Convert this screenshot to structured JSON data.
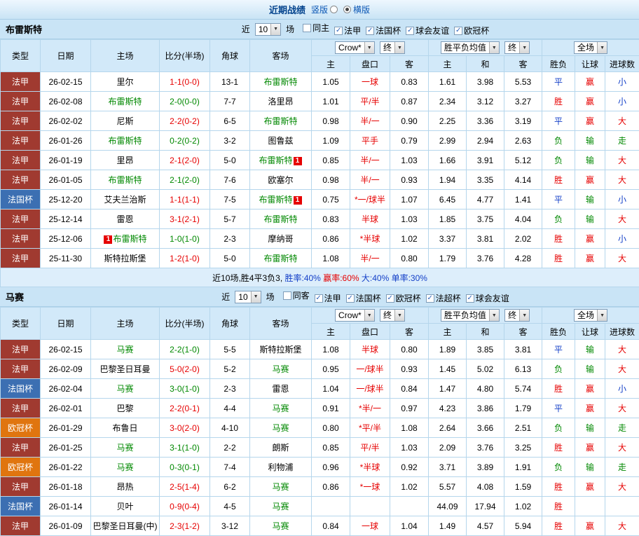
{
  "page": {
    "title": "近期战绩",
    "view_options": [
      {
        "label": "竖版",
        "selected": false
      },
      {
        "label": "横版",
        "selected": true
      }
    ]
  },
  "table_header": {
    "cols": [
      "类型",
      "日期",
      "主场",
      "比分(半场)",
      "角球",
      "客场"
    ],
    "bookmaker": "Crow*",
    "final_label": "终",
    "avg_label": "胜平负均值",
    "final_label2": "终",
    "scope_label": "全场",
    "sub_cols": [
      "主",
      "盘口",
      "客",
      "主",
      "和",
      "客",
      "胜负",
      "让球",
      "进球数"
    ]
  },
  "badge": {
    "text": "1"
  },
  "colors": {
    "type_bg": {
      "法甲": "#a03a30",
      "法国杯": "#3c6fb2",
      "欧冠杯": "#e0750f"
    },
    "result": {
      "胜": "#e60000",
      "平": "#1440c8",
      "负": "#008800"
    },
    "handicap_result": {
      "赢": "#e60000",
      "输": "#008800"
    },
    "goals": {
      "大": "#e60000",
      "小": "#1440c8",
      "走": "#008800"
    },
    "score": {
      "home": "#008800",
      "away": "#e60000"
    },
    "focus_team": "#008800",
    "handicap_text": "#e60000"
  },
  "sections": [
    {
      "team": "布雷斯特",
      "filters": {
        "near_label": "近",
        "match_count": "10",
        "games_label": "场",
        "checkboxes": [
          {
            "label": "同主",
            "checked": false
          },
          {
            "label": "法甲",
            "checked": true
          },
          {
            "label": "法国杯",
            "checked": true
          },
          {
            "label": "球会友谊",
            "checked": true
          },
          {
            "label": "欧冠杯",
            "checked": true
          }
        ]
      },
      "rows": [
        {
          "type": "法甲",
          "date": "26-02-15",
          "home": "里尔",
          "score": "1-1(0-0)",
          "corner": "13-1",
          "away": "布雷斯特",
          "focus": "away",
          "badge": null,
          "odds_home": "1.05",
          "handicap": "一球",
          "odds_away": "0.83",
          "avg_home": "1.61",
          "avg_draw": "3.98",
          "avg_away": "5.53",
          "result": "平",
          "handicap_result": "赢",
          "goals": "小"
        },
        {
          "type": "法甲",
          "date": "26-02-08",
          "home": "布雷斯特",
          "score": "2-0(0-0)",
          "corner": "7-7",
          "away": "洛里昂",
          "focus": "home",
          "badge": null,
          "odds_home": "1.01",
          "handicap": "平/半",
          "odds_away": "0.87",
          "avg_home": "2.34",
          "avg_draw": "3.12",
          "avg_away": "3.27",
          "result": "胜",
          "handicap_result": "赢",
          "goals": "小"
        },
        {
          "type": "法甲",
          "date": "26-02-02",
          "home": "尼斯",
          "score": "2-2(0-2)",
          "corner": "6-5",
          "away": "布雷斯特",
          "focus": "away",
          "badge": null,
          "odds_home": "0.98",
          "handicap": "半/一",
          "odds_away": "0.90",
          "avg_home": "2.25",
          "avg_draw": "3.36",
          "avg_away": "3.19",
          "result": "平",
          "handicap_result": "赢",
          "goals": "大"
        },
        {
          "type": "法甲",
          "date": "26-01-26",
          "home": "布雷斯特",
          "score": "0-2(0-2)",
          "corner": "3-2",
          "away": "图鲁兹",
          "focus": "home",
          "badge": null,
          "odds_home": "1.09",
          "handicap": "平手",
          "odds_away": "0.79",
          "avg_home": "2.99",
          "avg_draw": "2.94",
          "avg_away": "2.63",
          "result": "负",
          "handicap_result": "输",
          "goals": "走"
        },
        {
          "type": "法甲",
          "date": "26-01-19",
          "home": "里昂",
          "score": "2-1(2-0)",
          "corner": "5-0",
          "away": "布雷斯特",
          "focus": "away",
          "badge": {
            "side": "away",
            "pos": "after"
          },
          "odds_home": "0.85",
          "handicap": "半/一",
          "odds_away": "1.03",
          "avg_home": "1.66",
          "avg_draw": "3.91",
          "avg_away": "5.12",
          "result": "负",
          "handicap_result": "输",
          "goals": "大"
        },
        {
          "type": "法甲",
          "date": "26-01-05",
          "home": "布雷斯特",
          "score": "2-1(2-0)",
          "corner": "7-6",
          "away": "欧塞尔",
          "focus": "home",
          "badge": null,
          "odds_home": "0.98",
          "handicap": "半/一",
          "odds_away": "0.93",
          "avg_home": "1.94",
          "avg_draw": "3.35",
          "avg_away": "4.14",
          "result": "胜",
          "handicap_result": "赢",
          "goals": "大"
        },
        {
          "type": "法国杯",
          "date": "25-12-20",
          "home": "艾夫兰治斯",
          "score": "1-1(1-1)",
          "corner": "7-5",
          "away": "布雷斯特",
          "focus": "away",
          "badge": {
            "side": "away",
            "pos": "after"
          },
          "odds_home": "0.75",
          "handicap": "*一/球半",
          "odds_away": "1.07",
          "avg_home": "6.45",
          "avg_draw": "4.77",
          "avg_away": "1.41",
          "result": "平",
          "handicap_result": "输",
          "goals": "小"
        },
        {
          "type": "法甲",
          "date": "25-12-14",
          "home": "雷恩",
          "score": "3-1(2-1)",
          "corner": "5-7",
          "away": "布雷斯特",
          "focus": "away",
          "badge": null,
          "odds_home": "0.83",
          "handicap": "半球",
          "odds_away": "1.03",
          "avg_home": "1.85",
          "avg_draw": "3.75",
          "avg_away": "4.04",
          "result": "负",
          "handicap_result": "输",
          "goals": "大"
        },
        {
          "type": "法甲",
          "date": "25-12-06",
          "home": "布雷斯特",
          "score": "1-0(1-0)",
          "corner": "2-3",
          "away": "摩纳哥",
          "focus": "home",
          "badge": {
            "side": "home",
            "pos": "before"
          },
          "odds_home": "0.86",
          "handicap": "*半球",
          "odds_away": "1.02",
          "avg_home": "3.37",
          "avg_draw": "3.81",
          "avg_away": "2.02",
          "result": "胜",
          "handicap_result": "赢",
          "goals": "小"
        },
        {
          "type": "法甲",
          "date": "25-11-30",
          "home": "斯特拉斯堡",
          "score": "1-2(1-0)",
          "corner": "5-0",
          "away": "布雷斯特",
          "focus": "away",
          "badge": null,
          "odds_home": "1.08",
          "handicap": "半/一",
          "odds_away": "0.80",
          "avg_home": "1.79",
          "avg_draw": "3.76",
          "avg_away": "4.28",
          "result": "胜",
          "handicap_result": "赢",
          "goals": "大"
        }
      ],
      "summary": [
        {
          "text": "近10场,胜4平3负3, ",
          "color": "#000000"
        },
        {
          "text": "胜率:40%",
          "color": "#1440c8"
        },
        {
          "text": " 赢率:60%",
          "color": "#e60000"
        },
        {
          "text": " 大:40%",
          "color": "#1440c8"
        },
        {
          "text": " 单率:30%",
          "color": "#1440c8"
        }
      ]
    },
    {
      "team": "马赛",
      "filters": {
        "near_label": "近",
        "match_count": "10",
        "games_label": "场",
        "checkboxes": [
          {
            "label": "同客",
            "checked": false
          },
          {
            "label": "法甲",
            "checked": true
          },
          {
            "label": "法国杯",
            "checked": true
          },
          {
            "label": "欧冠杯",
            "checked": true
          },
          {
            "label": "法超杯",
            "checked": true
          },
          {
            "label": "球会友谊",
            "checked": true
          }
        ]
      },
      "rows": [
        {
          "type": "法甲",
          "date": "26-02-15",
          "home": "马赛",
          "score": "2-2(1-0)",
          "corner": "5-5",
          "away": "斯特拉斯堡",
          "focus": "home",
          "badge": null,
          "odds_home": "1.08",
          "handicap": "半球",
          "odds_away": "0.80",
          "avg_home": "1.89",
          "avg_draw": "3.85",
          "avg_away": "3.81",
          "result": "平",
          "handicap_result": "输",
          "goals": "大"
        },
        {
          "type": "法甲",
          "date": "26-02-09",
          "home": "巴黎圣日耳曼",
          "score": "5-0(2-0)",
          "corner": "5-2",
          "away": "马赛",
          "focus": "away",
          "badge": null,
          "odds_home": "0.95",
          "handicap": "一/球半",
          "odds_away": "0.93",
          "avg_home": "1.45",
          "avg_draw": "5.02",
          "avg_away": "6.13",
          "result": "负",
          "handicap_result": "输",
          "goals": "大"
        },
        {
          "type": "法国杯",
          "date": "26-02-04",
          "home": "马赛",
          "score": "3-0(1-0)",
          "corner": "2-3",
          "away": "雷恩",
          "focus": "home",
          "badge": null,
          "odds_home": "1.04",
          "handicap": "一/球半",
          "odds_away": "0.84",
          "avg_home": "1.47",
          "avg_draw": "4.80",
          "avg_away": "5.74",
          "result": "胜",
          "handicap_result": "赢",
          "goals": "小"
        },
        {
          "type": "法甲",
          "date": "26-02-01",
          "home": "巴黎",
          "score": "2-2(0-1)",
          "corner": "4-4",
          "away": "马赛",
          "focus": "away",
          "badge": null,
          "odds_home": "0.91",
          "handicap": "*半/一",
          "odds_away": "0.97",
          "avg_home": "4.23",
          "avg_draw": "3.86",
          "avg_away": "1.79",
          "result": "平",
          "handicap_result": "赢",
          "goals": "大"
        },
        {
          "type": "欧冠杯",
          "date": "26-01-29",
          "home": "布鲁日",
          "score": "3-0(2-0)",
          "corner": "4-10",
          "away": "马赛",
          "focus": "away",
          "badge": null,
          "odds_home": "0.80",
          "handicap": "*平/半",
          "odds_away": "1.08",
          "avg_home": "2.64",
          "avg_draw": "3.66",
          "avg_away": "2.51",
          "result": "负",
          "handicap_result": "输",
          "goals": "走"
        },
        {
          "type": "法甲",
          "date": "26-01-25",
          "home": "马赛",
          "score": "3-1(1-0)",
          "corner": "2-2",
          "away": "朗斯",
          "focus": "home",
          "badge": null,
          "odds_home": "0.85",
          "handicap": "平/半",
          "odds_away": "1.03",
          "avg_home": "2.09",
          "avg_draw": "3.76",
          "avg_away": "3.25",
          "result": "胜",
          "handicap_result": "赢",
          "goals": "大"
        },
        {
          "type": "欧冠杯",
          "date": "26-01-22",
          "home": "马赛",
          "score": "0-3(0-1)",
          "corner": "7-4",
          "away": "利物浦",
          "focus": "home",
          "badge": null,
          "odds_home": "0.96",
          "handicap": "*半球",
          "odds_away": "0.92",
          "avg_home": "3.71",
          "avg_draw": "3.89",
          "avg_away": "1.91",
          "result": "负",
          "handicap_result": "输",
          "goals": "走"
        },
        {
          "type": "法甲",
          "date": "26-01-18",
          "home": "昂热",
          "score": "2-5(1-4)",
          "corner": "6-2",
          "away": "马赛",
          "focus": "away",
          "badge": null,
          "odds_home": "0.86",
          "handicap": "*一球",
          "odds_away": "1.02",
          "avg_home": "5.57",
          "avg_draw": "4.08",
          "avg_away": "1.59",
          "result": "胜",
          "handicap_result": "赢",
          "goals": "大"
        },
        {
          "type": "法国杯",
          "date": "26-01-14",
          "home": "贝叶",
          "score": "0-9(0-4)",
          "corner": "4-5",
          "away": "马赛",
          "focus": "away",
          "badge": null,
          "odds_home": "",
          "handicap": "",
          "odds_away": "",
          "avg_home": "44.09",
          "avg_draw": "17.94",
          "avg_away": "1.02",
          "result": "胜",
          "handicap_result": "",
          "goals": ""
        },
        {
          "type": "法甲",
          "date": "26-01-09",
          "home": "巴黎圣日耳曼(中)",
          "score": "2-3(1-2)",
          "corner": "3-12",
          "away": "马赛",
          "focus": "away",
          "badge": null,
          "odds_home": "0.84",
          "handicap": "一球",
          "odds_away": "1.04",
          "avg_home": "1.49",
          "avg_draw": "4.57",
          "avg_away": "5.94",
          "result": "胜",
          "handicap_result": "赢",
          "goals": "大"
        }
      ]
    }
  ]
}
